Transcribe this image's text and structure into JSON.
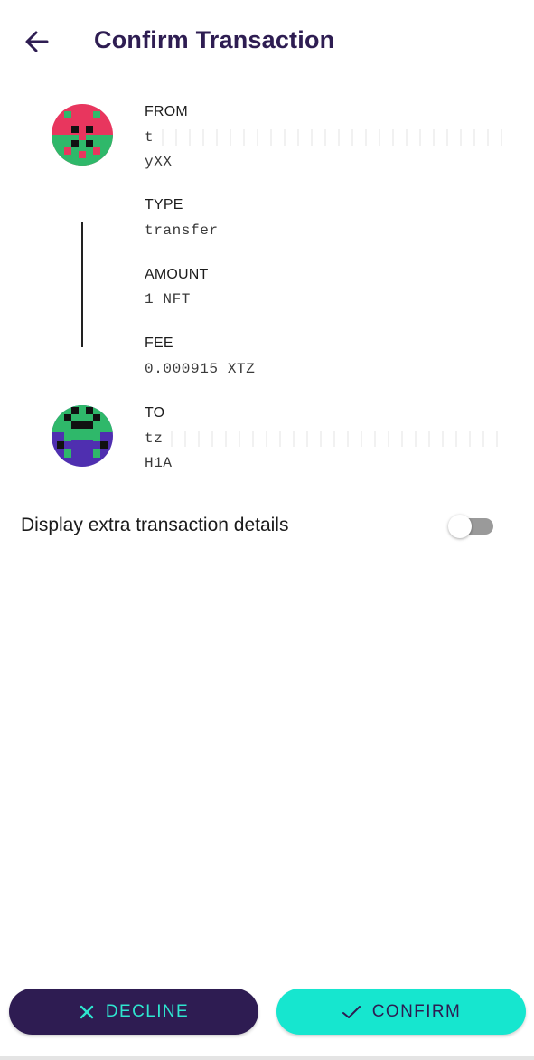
{
  "header": {
    "title": "Confirm Transaction"
  },
  "transaction": {
    "from": {
      "label": "FROM",
      "address_visible_end": "yXX",
      "address_prefix": "t"
    },
    "type": {
      "label": "TYPE",
      "value": "transfer"
    },
    "amount": {
      "label": "AMOUNT",
      "value": "1 NFT"
    },
    "fee": {
      "label": "FEE",
      "value": "0.000915 XTZ"
    },
    "to": {
      "label": "TO",
      "address_prefix": "tz",
      "address_visible_end": "H1A"
    }
  },
  "options": {
    "extra_details_label": "Display extra transaction details",
    "extra_details_enabled": false
  },
  "actions": {
    "decline_label": "DECLINE",
    "confirm_label": "CONFIRM"
  },
  "colors": {
    "primary_dark": "#2e1c52",
    "accent_teal": "#16e6cf",
    "from_avatar_bg": "#e8365e",
    "from_avatar_accent": "#2fb86a",
    "to_avatar_bg": "#4f2fb0",
    "to_avatar_accent": "#2fb86a"
  }
}
